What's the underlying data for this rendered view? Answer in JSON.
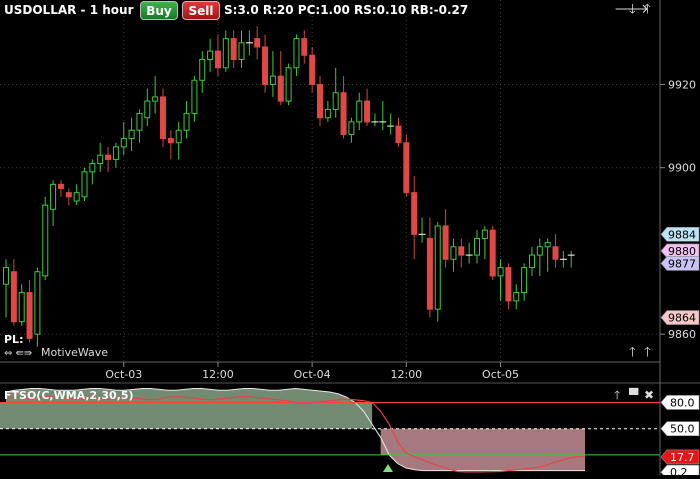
{
  "header": {
    "symbol": "USDOLLAR - 1 hour",
    "buy_label": "Buy",
    "sell_label": "Sell",
    "params": "S:3.0  R:20  PC:1.00  RS:0.10  RB:-0.27"
  },
  "nav_icons": [
    "arrow-right-icon",
    "arrow-down-icon",
    "arrow-up-icon"
  ],
  "price_axis": {
    "ticks": [
      "9920",
      "9900",
      "9860"
    ],
    "tick_values": [
      9920,
      9900,
      9860
    ],
    "min": 9855,
    "max": 9935,
    "markers": [
      {
        "label": "9884",
        "value": 9884,
        "color": "#bfe3f5"
      },
      {
        "label": "9880",
        "value": 9880,
        "color": "#f0c2f0"
      },
      {
        "label": "9877",
        "value": 9877,
        "color": "#c9c4f5"
      },
      {
        "label": "9864",
        "value": 9864,
        "color": "#f5c8c8"
      }
    ]
  },
  "time_axis": {
    "labels": [
      {
        "text": "Oct-03",
        "index": 15
      },
      {
        "text": "12:00",
        "index": 27
      },
      {
        "text": "Oct-04",
        "index": 39
      },
      {
        "text": "12:00",
        "index": 51
      },
      {
        "text": "Oct-05",
        "index": 63
      }
    ]
  },
  "pl_label": "PL:",
  "brand": "MotiveWave",
  "indicator": {
    "title": "FTSO(C,WMA,2,30,5)",
    "levels": [
      {
        "label": "80.0",
        "value": 80,
        "color": "#ff4040",
        "style": "solid"
      },
      {
        "label": "50.0",
        "value": 50,
        "color": "#ffffff",
        "style": "dashed"
      },
      {
        "label": "17.7",
        "value": 17.7,
        "color": "#e01818",
        "style": "box"
      },
      {
        "label": "0.2",
        "value": 0.2,
        "color": "#ffffff",
        "style": "box"
      }
    ],
    "upper_guide": 80,
    "lower_guide": 20,
    "min": -3,
    "max": 100,
    "fill_high_color": "#7f9a7f",
    "fill_low_color": "#b07f85"
  },
  "colors": {
    "up": "#3ec93e",
    "down": "#e04848",
    "background": "#000000",
    "grid": "#3a3a3a"
  },
  "chart_data": {
    "type": "candlestick",
    "title": "USDOLLAR - 1 hour",
    "ylim": [
      9855,
      9935
    ],
    "candles": [
      [
        9872,
        9878,
        9864,
        9876
      ],
      [
        9875,
        9878,
        9862,
        9863
      ],
      [
        9863,
        9872,
        9862,
        9870
      ],
      [
        9870,
        9873,
        9858,
        9859
      ],
      [
        9860,
        9876,
        9857,
        9875
      ],
      [
        9874,
        9893,
        9873,
        9891
      ],
      [
        9890,
        9897,
        9886,
        9896
      ],
      [
        9896,
        9897,
        9893,
        9895
      ],
      [
        9894,
        9895,
        9891,
        9893
      ],
      [
        9892,
        9896,
        9891,
        9894
      ],
      [
        9893,
        9900,
        9892,
        9899
      ],
      [
        9899,
        9902,
        9896,
        9901
      ],
      [
        9901,
        9906,
        9899,
        9903
      ],
      [
        9903,
        9905,
        9899,
        9902
      ],
      [
        9902,
        9906,
        9900,
        9905
      ],
      [
        9905,
        9911,
        9903,
        9907
      ],
      [
        9907,
        9912,
        9904,
        9909
      ],
      [
        9909,
        9914,
        9906,
        9913
      ],
      [
        9912,
        9919,
        9910,
        9916
      ],
      [
        9916,
        9922,
        9913,
        9917
      ],
      [
        9917,
        9919,
        9905,
        9907
      ],
      [
        9907,
        9909,
        9902,
        9906
      ],
      [
        9906,
        9911,
        9902,
        9909
      ],
      [
        9909,
        9916,
        9907,
        9913
      ],
      [
        9913,
        9922,
        9911,
        9921
      ],
      [
        9921,
        9928,
        9918,
        9926
      ],
      [
        9926,
        9931,
        9923,
        9928
      ],
      [
        9928,
        9932,
        9922,
        9924
      ],
      [
        9924,
        9933,
        9923,
        9931
      ],
      [
        9931,
        9933,
        9924,
        9926
      ],
      [
        9926,
        9933,
        9924,
        9930
      ],
      [
        9930,
        9933,
        9927,
        9930
      ],
      [
        9931,
        9934,
        9926,
        9929
      ],
      [
        9929,
        9932,
        9918,
        9920
      ],
      [
        9920,
        9928,
        9917,
        9922
      ],
      [
        9922,
        9928,
        9915,
        9916
      ],
      [
        9916,
        9925,
        9915,
        9924
      ],
      [
        9924,
        9932,
        9922,
        9931
      ],
      [
        9931,
        9933,
        9925,
        9927
      ],
      [
        9927,
        9929,
        9918,
        9920
      ],
      [
        9920,
        9922,
        9910,
        9912
      ],
      [
        9912,
        9916,
        9911,
        9914
      ],
      [
        9914,
        9924,
        9912,
        9918
      ],
      [
        9918,
        9922,
        9907,
        9908
      ],
      [
        9908,
        9912,
        9906,
        9911
      ],
      [
        9911,
        9918,
        9909,
        9916
      ],
      [
        9916,
        9919,
        9910,
        9911
      ],
      [
        9911,
        9913,
        9910,
        9911
      ],
      [
        9911,
        9916,
        9909,
        9911
      ],
      [
        9910,
        9913,
        9908,
        9910
      ],
      [
        9910,
        9912,
        9905,
        9906
      ],
      [
        9906,
        9908,
        9893,
        9894
      ],
      [
        9894,
        9898,
        9878,
        9884
      ],
      [
        9884,
        9888,
        9882,
        9884
      ],
      [
        9883,
        9888,
        9864,
        9866
      ],
      [
        9866,
        9887,
        9863,
        9886
      ],
      [
        9886,
        9890,
        9876,
        9878
      ],
      [
        9878,
        9883,
        9875,
        9881
      ],
      [
        9881,
        9883,
        9876,
        9879
      ],
      [
        9879,
        9882,
        9877,
        9879
      ],
      [
        9879,
        9885,
        9877,
        9883
      ],
      [
        9883,
        9886,
        9878,
        9885
      ],
      [
        9885,
        9886,
        9873,
        9874
      ],
      [
        9874,
        9878,
        9868,
        9876
      ],
      [
        9876,
        9877,
        9866,
        9868
      ],
      [
        9868,
        9872,
        9866,
        9870
      ],
      [
        9870,
        9877,
        9868,
        9876
      ],
      [
        9876,
        9881,
        9874,
        9879
      ],
      [
        9879,
        9883,
        9874,
        9881
      ],
      [
        9881,
        9883,
        9875,
        9882
      ],
      [
        9881,
        9884,
        9876,
        9878
      ],
      [
        9878,
        9880,
        9876,
        9878
      ],
      [
        9879,
        9880,
        9876,
        9879
      ]
    ],
    "oscillator_ylim": [
      -3,
      100
    ],
    "oscillator": [
      85,
      86,
      85,
      84,
      86,
      87,
      86,
      85,
      84,
      85,
      86,
      85,
      84,
      85,
      86,
      85,
      84,
      83,
      84,
      86,
      87,
      86,
      85,
      84,
      83,
      84,
      85,
      86,
      87,
      86,
      85,
      84,
      83,
      82,
      80,
      79,
      80,
      81,
      82,
      83,
      84,
      83,
      82,
      80,
      70,
      55,
      35,
      22,
      18,
      14,
      10,
      7,
      4,
      1,
      0.5,
      0.5,
      0.6,
      0.8,
      1,
      2,
      3,
      4,
      5,
      7,
      10,
      13,
      16,
      18,
      17.7
    ],
    "oscillator_fill_high": [
      92,
      94,
      95,
      96,
      96,
      95,
      94,
      94,
      94,
      95,
      96,
      96,
      95,
      94,
      94,
      95,
      96,
      96,
      95,
      94,
      94,
      95,
      96,
      96,
      95,
      94,
      94,
      95,
      96,
      96,
      95,
      94,
      94,
      95,
      96,
      95,
      94,
      93,
      92,
      90,
      86,
      80,
      70,
      55,
      40,
      20,
      10,
      5,
      3,
      2,
      2,
      2,
      2,
      2,
      2,
      2,
      2,
      2,
      2,
      2,
      2,
      2,
      2,
      2,
      2,
      2,
      2,
      2,
      2
    ]
  }
}
